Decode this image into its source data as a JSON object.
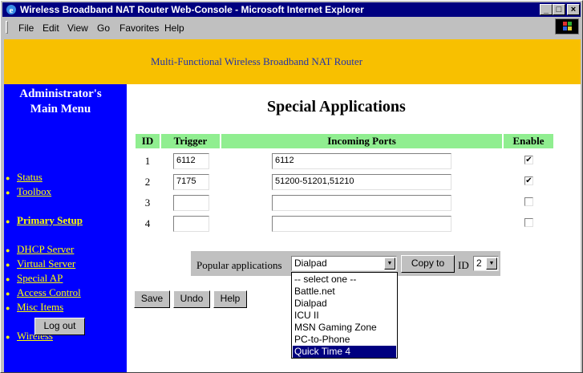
{
  "window": {
    "title": "Wireless Broadband NAT Router Web-Console - Microsoft Internet Explorer",
    "controls": {
      "minimize": "_",
      "maximize": "□",
      "close": "×"
    }
  },
  "menu": {
    "items": [
      "File",
      "Edit",
      "View",
      "Go",
      "Favorites",
      "Help"
    ]
  },
  "banner": {
    "text": "Multi-Functional Wireless Broadband NAT Router"
  },
  "sidebar": {
    "heading_line1": "Administrator's",
    "heading_line2": "Main Menu",
    "links": [
      "Status",
      "Toolbox",
      "Primary Setup",
      "DHCP Server",
      "Virtual Server",
      "Special AP",
      "Access Control",
      "Misc Items",
      "Wireless"
    ],
    "logout_label": "Log out"
  },
  "main": {
    "heading": "Special Applications",
    "columns": [
      "ID",
      "Trigger",
      "Incoming Ports",
      "Enable"
    ],
    "rows": [
      {
        "id": "1",
        "trigger": "6112",
        "ports": "6112",
        "enabled": "✔"
      },
      {
        "id": "2",
        "trigger": "7175",
        "ports": "51200-51201,51210",
        "enabled": "✔"
      },
      {
        "id": "3",
        "trigger": "",
        "ports": "",
        "enabled": ""
      },
      {
        "id": "4",
        "trigger": "",
        "ports": "",
        "enabled": ""
      }
    ],
    "popular_label": "Popular applications",
    "popular_selected": "Dialpad",
    "copy_to_label": "Copy to",
    "id_label": "ID",
    "id_selected": "2",
    "dropdown_options": [
      "-- select one --",
      "Battle.net",
      "Dialpad",
      "ICU II",
      "MSN Gaming Zone",
      "PC-to-Phone",
      "Quick Time 4"
    ],
    "highlighted_option": "Quick Time 4",
    "save_label": "Save",
    "undo_label": "Undo",
    "help_label": "Help"
  },
  "colors": {
    "title_bar": "#000080",
    "banner": "#f8c000",
    "sidebar": "#0000ff",
    "sidebar_links": "#ffff00",
    "table_header": "#90ee90"
  }
}
